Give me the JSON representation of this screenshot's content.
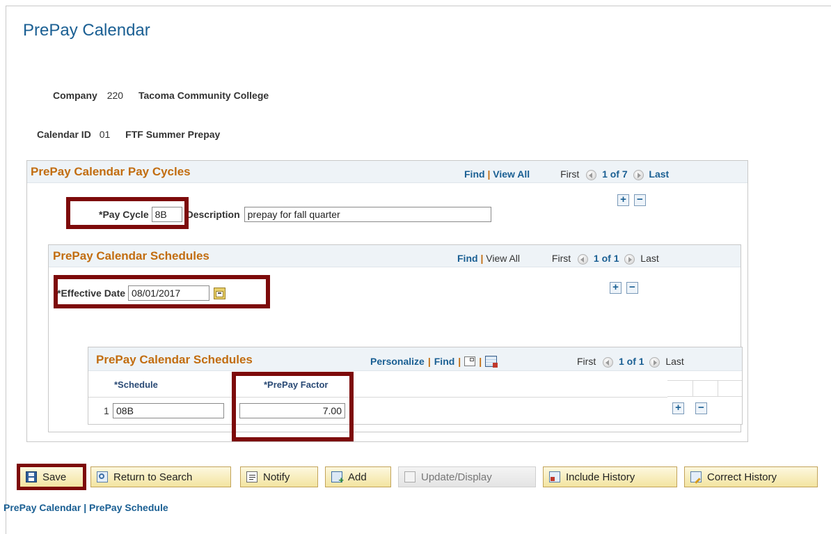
{
  "page": {
    "title": "PrePay Calendar"
  },
  "company": {
    "label": "Company",
    "code": "220",
    "name": "Tacoma Community College"
  },
  "calendar": {
    "label": "Calendar ID",
    "code": "01",
    "name": "FTF Summer Prepay"
  },
  "pay_cycles": {
    "title": "PrePay Calendar Pay Cycles",
    "find": "Find",
    "view_all": "View All",
    "sep": "|",
    "first": "First",
    "count": "1 of 7",
    "last": "Last",
    "pay_cycle_label": "*Pay Cycle",
    "pay_cycle_value": "8B",
    "description_label": "Description",
    "description_value": "prepay for fall quarter"
  },
  "schedules_outer": {
    "title": "PrePay Calendar Schedules",
    "find": "Find",
    "view_all": "View All",
    "sep": "|",
    "first": "First",
    "count": "1 of 1",
    "last": "Last",
    "effective_date_label": "*Effective Date",
    "effective_date_value": "08/01/2017"
  },
  "schedules_inner": {
    "title": "PrePay Calendar Schedules",
    "personalize": "Personalize",
    "find": "Find",
    "sep": "|",
    "first": "First",
    "count": "1 of 1",
    "last": "Last",
    "columns": [
      "*Schedule",
      "*PrePay Factor"
    ],
    "rows": [
      {
        "num": "1",
        "schedule": "08B",
        "factor": "7.00"
      }
    ]
  },
  "toolbar": {
    "save": "Save",
    "return_to_search": "Return to Search",
    "notify": "Notify",
    "add": "Add",
    "update_display": "Update/Display",
    "include_history": "Include History",
    "correct_history": "Correct History"
  },
  "footer_links": {
    "link1": "PrePay Calendar",
    "sep": "|",
    "link2": "PrePay Schedule"
  },
  "colors": {
    "title_blue": "#1a5f93",
    "section_orange": "#c26d10",
    "highlight": "#7d0a0a",
    "button_gold": "#f3e4a0"
  }
}
